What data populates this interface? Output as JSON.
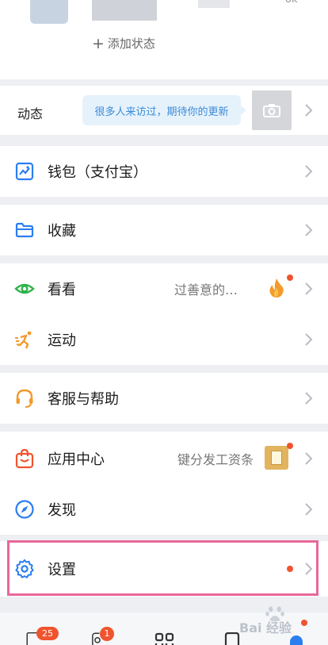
{
  "profile": {
    "add_status": "添加状态",
    "corner_text": "ok"
  },
  "dynamic": {
    "label": "动态",
    "bubble": "很多人来访过，期待你的更新"
  },
  "menu": {
    "wallet": "钱包（支付宝）",
    "favorites": "收藏",
    "kankan": "看看",
    "kankan_sub": "过善意的…",
    "sport": "运动",
    "service": "客服与帮助",
    "app_center": "应用中心",
    "app_center_sub": "键分发工资条",
    "discover": "发现",
    "settings": "设置"
  },
  "tabbar": {
    "messages_badge": "25",
    "contacts_badge": "1"
  },
  "watermark": "Bai 经验",
  "colors": {
    "accent_blue": "#2a7ef0",
    "red_dot": "#f0542e",
    "highlight_border": "#e8689a",
    "bubble_bg": "#e6f2fb",
    "bubble_text": "#3a8bd8"
  }
}
